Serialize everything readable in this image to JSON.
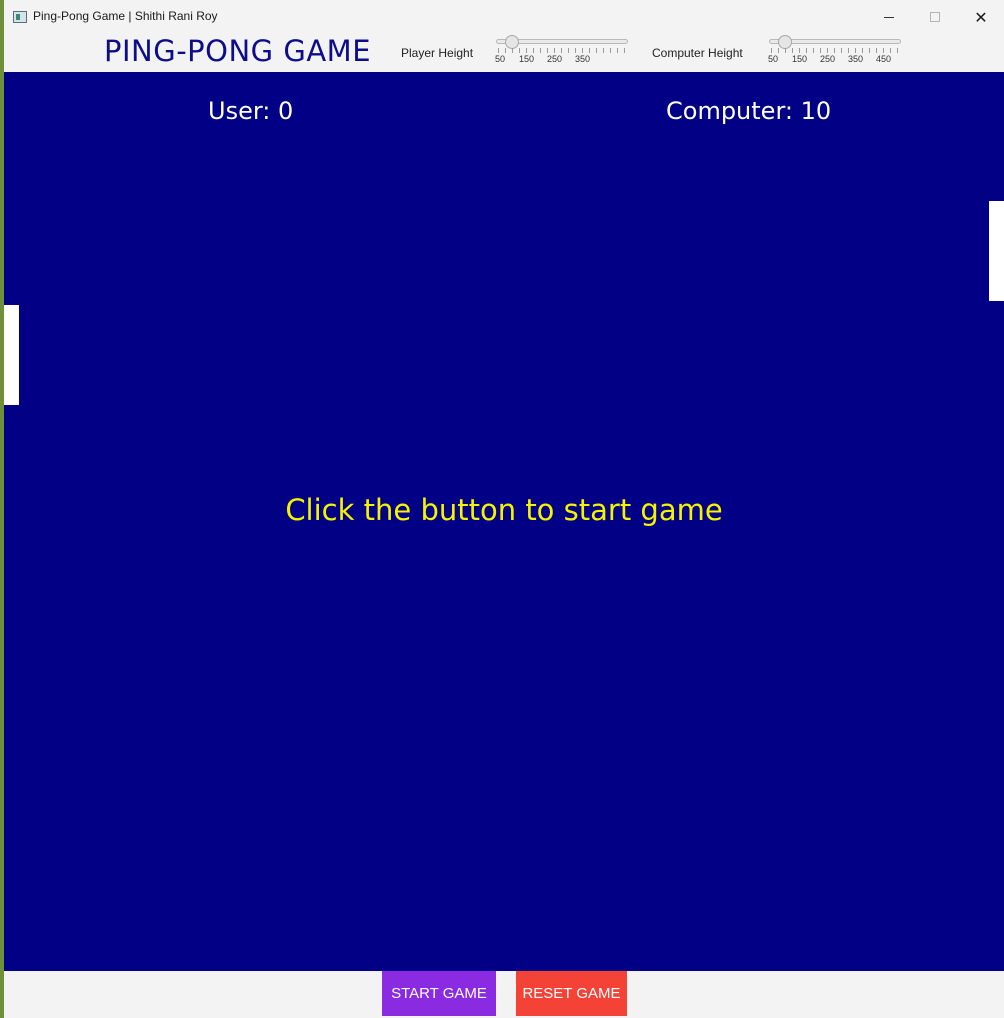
{
  "window": {
    "title": "Ping-Pong Game | Shithi Rani Roy",
    "minimize_icon": "minimize-icon",
    "maximize_icon": "maximize-icon",
    "close_glyph": "✕"
  },
  "toolbar": {
    "game_title": "PING-PONG GAME",
    "player_slider": {
      "label": "Player Height",
      "value": 50,
      "min": 50,
      "max": 400,
      "tick_labels": [
        "50",
        "150",
        "250",
        "350"
      ]
    },
    "computer_slider": {
      "label": "Computer Height",
      "value": 50,
      "min": 50,
      "max": 500,
      "tick_labels": [
        "50",
        "150",
        "250",
        "350",
        "450"
      ]
    }
  },
  "court": {
    "background_color": "#020085",
    "user_score": "User: 0",
    "computer_score": "Computer: 10",
    "message": "Click the button to start game",
    "message_color": "#f4f400"
  },
  "buttons": {
    "start_label": "START GAME",
    "start_color": "#8a2be2",
    "reset_label": "RESET GAME",
    "reset_color": "#f44336"
  }
}
